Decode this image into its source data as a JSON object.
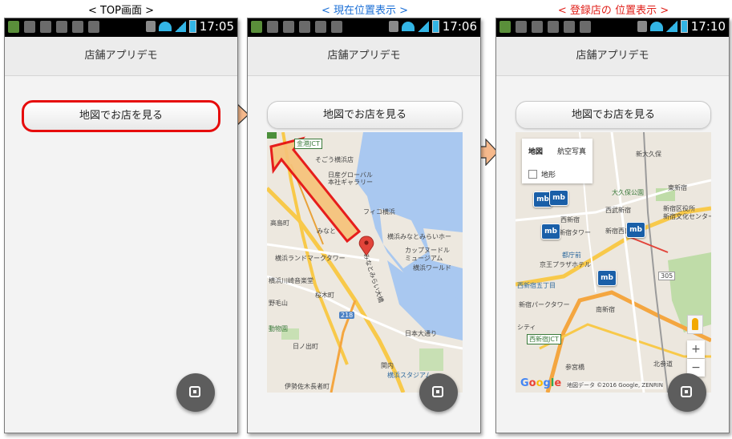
{
  "captions": [
    "< TOP画面 >",
    "< 現在位置表示 >",
    "< 登録店の 位置表示 >"
  ],
  "status_times": [
    "17:05",
    "17:06",
    "17:10"
  ],
  "app_title": "店舗アプリデモ",
  "map_button_label": "地図でお店を見る",
  "map2": {
    "labels": [
      "金港JCT",
      "そごう横浜店",
      "日産グローバル",
      "本社ギャラリー",
      "高島町",
      "みなと",
      "フィコ横浜",
      "横浜みなとみらいホー",
      "横浜ランドマークタワー",
      "カップヌードル",
      "ミュージアム",
      "横浜ワールド",
      "横浜川崎音楽堂",
      "桜木町",
      "野毛山",
      "動物園",
      "日ノ出町",
      "日本大通り",
      "関内",
      "横浜スタジアム",
      "伊勢佐木長者町",
      "みなとみらい大橋",
      "218"
    ]
  },
  "map3": {
    "maptype_tabs": [
      "地図",
      "航空写真"
    ],
    "terrain_label": "地形",
    "labels": [
      "新大久保",
      "大久保公園",
      "東新宿",
      "西武新宿",
      "西新宿",
      "新宿西口",
      "新宿区役所",
      "新宿タワー",
      "新宿文化センター",
      "都庁前",
      "京王プラザホテル",
      "西新宿五丁目",
      "新宿パークタワー",
      "南新宿",
      "参宮橋",
      "北参道",
      "西新宿JCT",
      "シティ",
      "305"
    ],
    "pin_label": "mb",
    "zoom_in": "+",
    "zoom_out": "−",
    "google": "Google",
    "attribution": "地図データ ©2016 Google, ZENRIN"
  },
  "colors": {
    "caption_black": "#000000",
    "caption_blue": "#1b6fd6",
    "caption_red": "#e0201a",
    "highlight_red": "#e60c0c",
    "arrow_fill": "#f6b98c",
    "arrow_stroke": "#333333",
    "pin_blue": "#1a5fa8"
  },
  "icons": [
    "grid-icon",
    "usb-icon",
    "android-icon",
    "bag-icon",
    "sync-icon",
    "sd-icon",
    "wifi-icon",
    "signal-icon",
    "battery-icon",
    "stop-icon"
  ]
}
